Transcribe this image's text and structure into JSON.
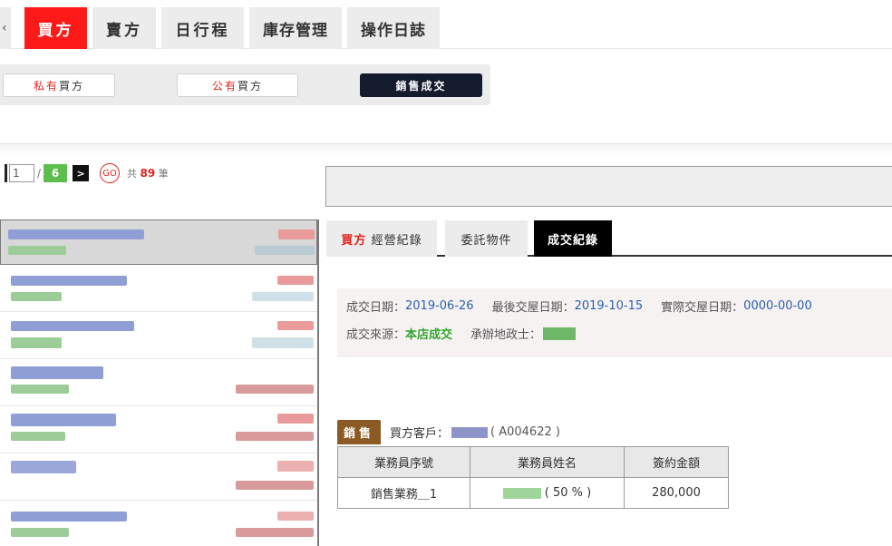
{
  "top_tabs": [
    {
      "label": "買方",
      "active": true
    },
    {
      "label": "賣方",
      "active": false
    },
    {
      "label": "日行程",
      "active": false
    },
    {
      "label": "庫存管理",
      "active": false
    },
    {
      "label": "操作日誌",
      "active": false
    }
  ],
  "sub_buttons": {
    "private_prefix": "私有",
    "private_suffix": "買方",
    "public_prefix": "公有",
    "public_suffix": "買方",
    "deal_label": "銷售成交"
  },
  "pager": {
    "current": "1",
    "slash": "/",
    "total_pages": "6",
    "next": ">",
    "go": "GO",
    "count_prefix": "共",
    "count": "89",
    "count_suffix": "筆"
  },
  "right_tabs": {
    "tab1_prefix": "買方",
    "tab1_suffix": "經營紀錄",
    "tab2": "委託物件",
    "tab3": "成交紀錄"
  },
  "deal_info": {
    "deal_date_label": "成交日期：",
    "deal_date": "2019-06-26",
    "last_date_label": "最後交屋日期：",
    "last_date": "2019-10-15",
    "actual_date_label": "實際交屋日期：",
    "actual_date": "0000-00-00",
    "source_label": "成交來源：",
    "source": "本店成交",
    "agent_label": "承辦地政士："
  },
  "sales": {
    "badge": "銷售",
    "buyer_label": "買方客戶：",
    "buyer_code": "( A004622 )",
    "headers": [
      "業務員序號",
      "業務員姓名",
      "簽約金額"
    ],
    "rows": [
      {
        "id": "銷售業務＿1",
        "percent": "( 50 % )",
        "amount": "280,000"
      }
    ]
  },
  "colors": {
    "accent_red": "#ff1a1a",
    "dark_button": "#141b2d",
    "date_blue": "#2a5fb0",
    "source_green": "#34a534",
    "amount_red": "#a31a1a",
    "sale_badge": "#8c5a24"
  }
}
